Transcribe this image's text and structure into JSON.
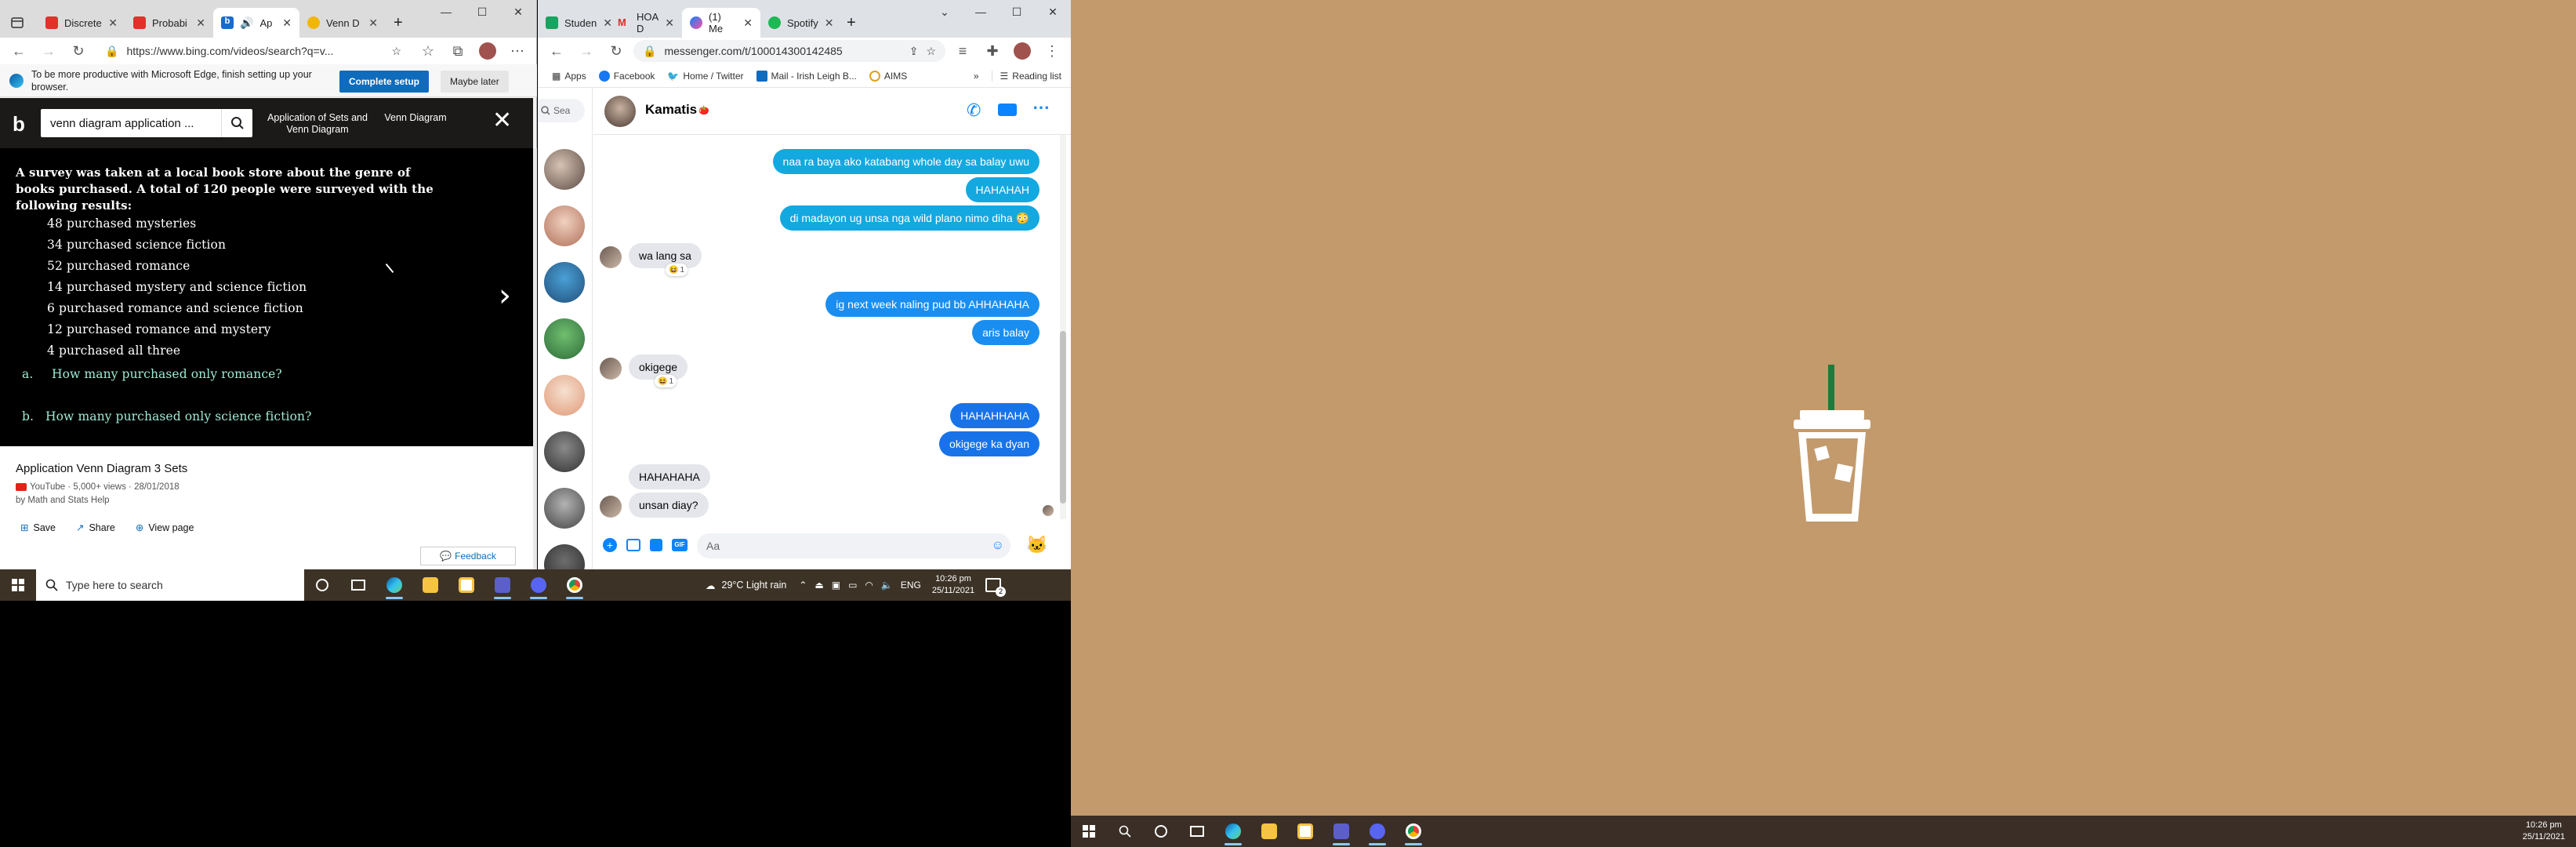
{
  "edge": {
    "tabs": [
      {
        "label": "Discrete",
        "color": "#e0312b"
      },
      {
        "label": "Probabi",
        "color": "#e0312b"
      },
      {
        "label": "Ap",
        "color": "#1b6ac9"
      },
      {
        "label": "Venn D",
        "color": "#f2b705"
      }
    ],
    "url": "https://www.bing.com/videos/search?q=v...",
    "infobar_text": "To be more productive with Microsoft Edge, finish setting up your browser.",
    "complete_setup": "Complete setup",
    "maybe_later": "Maybe later",
    "search_value": "venn diagram application ...",
    "bing_tabs": [
      "Application of Sets and Venn Diagram",
      "Venn Diagram"
    ],
    "video_text": {
      "intro": [
        "A survey was taken at a local book store about the genre of",
        "books purchased. A total of 120 people were surveyed with the",
        "following results:"
      ],
      "items": [
        "48  purchased  mysteries",
        "34  purchased  science  fiction",
        "52  purchased  romance",
        "14  purchased  mystery  and  science  fiction",
        "6  purchased  romance  and  science  fiction",
        "12  purchased  romance  and  mystery",
        "4  purchased  all  three"
      ],
      "question_a_label": "a.",
      "question_a": "How  many  purchased  only  romance?",
      "question_b_label": "b.",
      "question_b": "How  many  purchased  only  science  fiction?"
    },
    "video_title": "Application Venn Diagram 3 Sets",
    "video_meta": "YouTube · 5,000+ views · 28/01/2018",
    "video_by": "by Math and Stats Help",
    "actions": [
      "Save",
      "Share",
      "View page"
    ],
    "feedback": "Feedback"
  },
  "chrome": {
    "tabs": [
      {
        "label": "Studen",
        "color": "#1aa260"
      },
      {
        "label": "HOA D",
        "color": "#d93025"
      },
      {
        "label": "(1) Me",
        "color": "#a033ff"
      },
      {
        "label": "Spotify",
        "color": "#1db954"
      }
    ],
    "url": "messenger.com/t/100014300142485",
    "bookmarks": [
      "Apps",
      "Facebook",
      "Home / Twitter",
      "Mail - Irish Leigh B...",
      "AIMS"
    ],
    "reading_list": "Reading list",
    "search_placeholder": "Sea",
    "contact_name": "Kamatis",
    "messages": {
      "m1": "naa ra baya ako katabang whole day sa balay uwu",
      "m2": "HAHAHAH",
      "m3": "di madayon ug unsa nga wild plano nimo diha 😳",
      "m4": "wa lang sa",
      "m5": "ig next week naling pud bb AHHAHAHA",
      "m6": "aris balay",
      "m7": "okigege",
      "m8": "HAHAHHAHA",
      "m9": "okigege ka dyan",
      "m10": "HAHAHAHA",
      "m11": "unsan diay?",
      "reaction_count": "1"
    },
    "compose_placeholder": "Aa"
  },
  "taskbar1": {
    "search_placeholder": "Type here to search",
    "weather": "29°C  Light rain",
    "lang": "ENG",
    "time": "10:26 pm",
    "date": "25/11/2021",
    "notif_count": "2"
  },
  "taskbar2": {
    "time": "10:26 pm",
    "date": "25/11/2021"
  },
  "colors": {
    "wallpaper": "#c39a6b",
    "taskbar": "#3a2e26",
    "messenger_blue": "#0a84ff",
    "bing_dark": "#1b1a19"
  }
}
